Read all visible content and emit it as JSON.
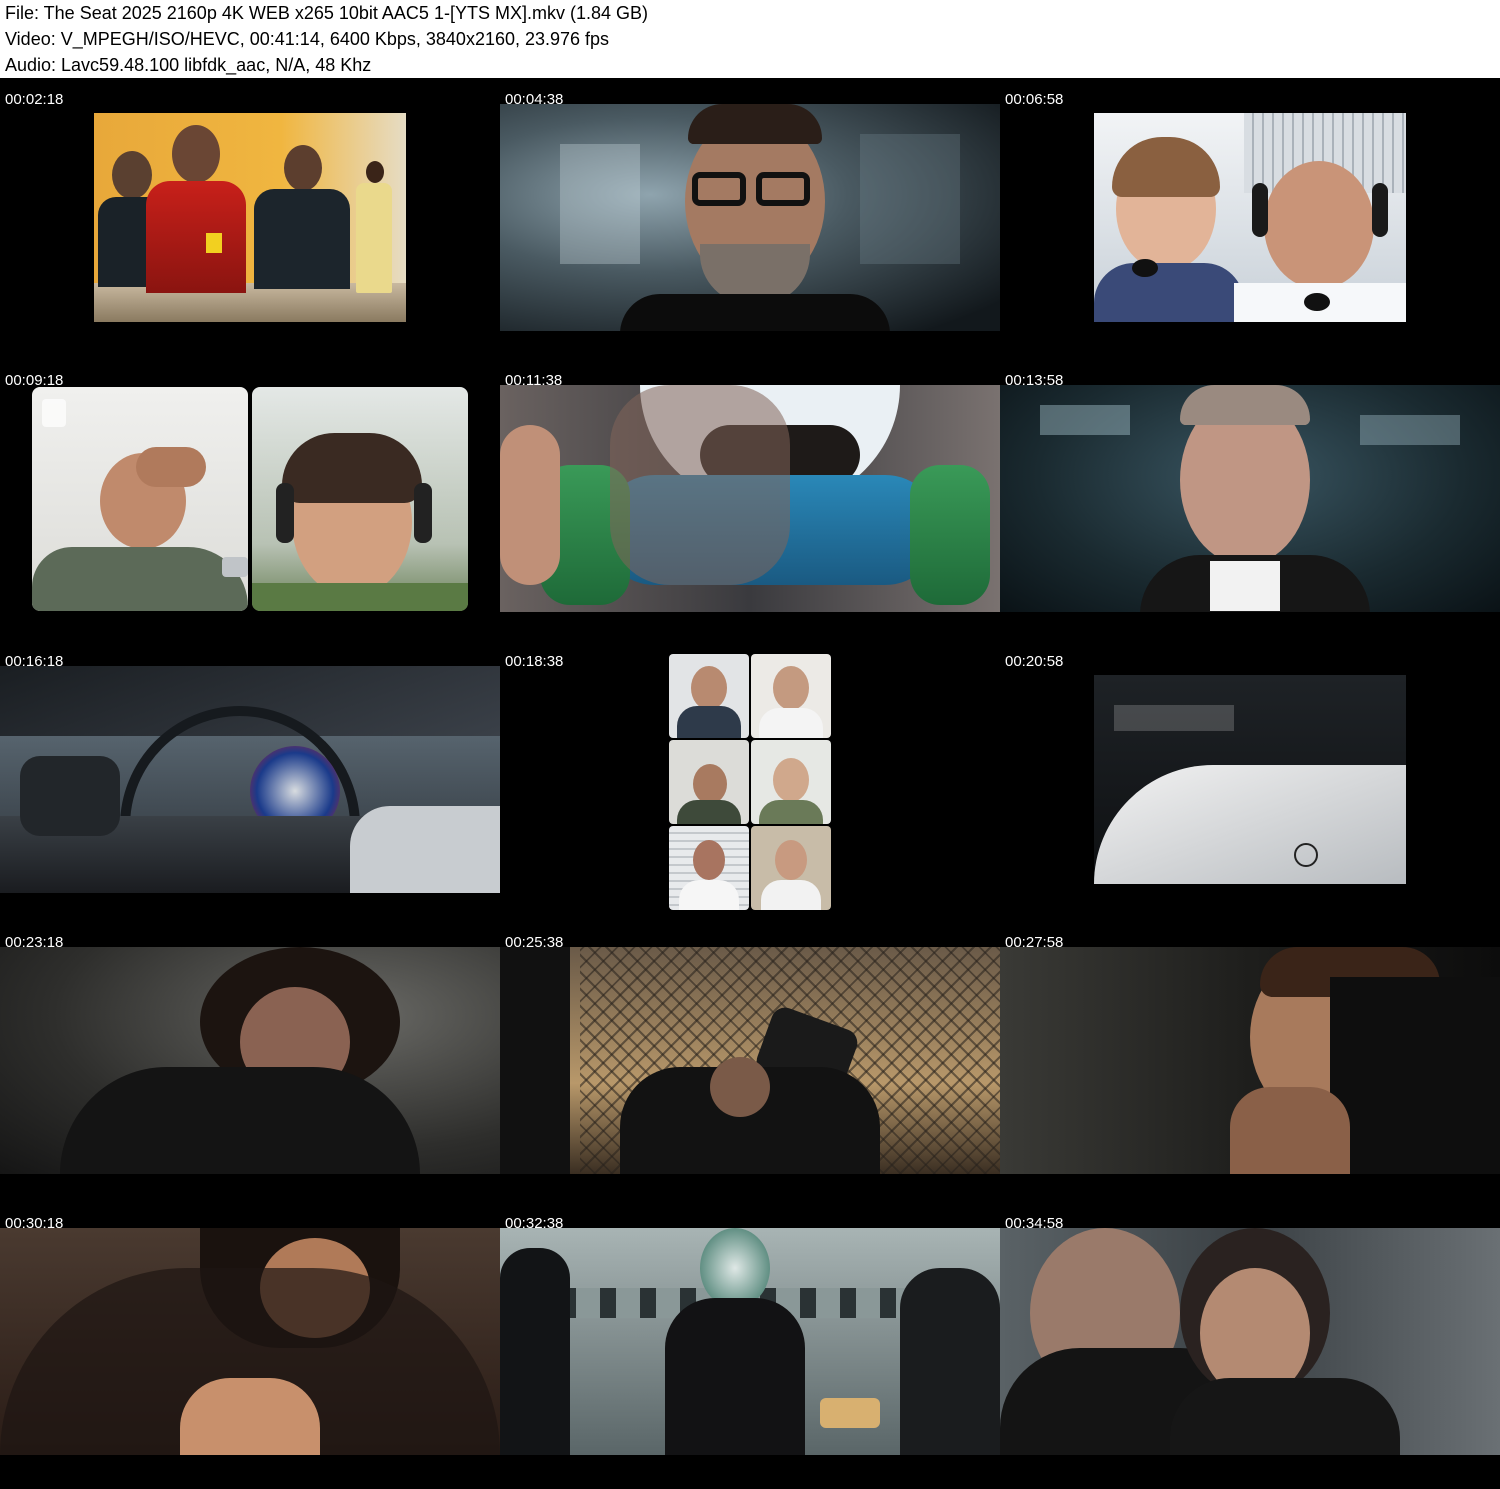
{
  "header": {
    "file": "File: The Seat 2025 2160p 4K WEB x265 10bit AAC5 1-[YTS MX].mkv (1.84 GB)",
    "video": "Video: V_MPEGH/ISO/HEVC, 00:41:14, 6400 Kbps, 3840x2160, 23.976 fps",
    "audio": "Audio: Lavc59.48.100 libfdk_aac, N/A, 48 Khz"
  },
  "thumbnails": [
    {
      "timestamp": "00:02:18"
    },
    {
      "timestamp": "00:04:38"
    },
    {
      "timestamp": "00:06:58"
    },
    {
      "timestamp": "00:09:18"
    },
    {
      "timestamp": "00:11:38"
    },
    {
      "timestamp": "00:13:58"
    },
    {
      "timestamp": "00:16:18"
    },
    {
      "timestamp": "00:18:38"
    },
    {
      "timestamp": "00:20:58"
    },
    {
      "timestamp": "00:23:18"
    },
    {
      "timestamp": "00:25:38"
    },
    {
      "timestamp": "00:27:58"
    },
    {
      "timestamp": "00:30:18"
    },
    {
      "timestamp": "00:32:38"
    },
    {
      "timestamp": "00:34:58"
    }
  ]
}
